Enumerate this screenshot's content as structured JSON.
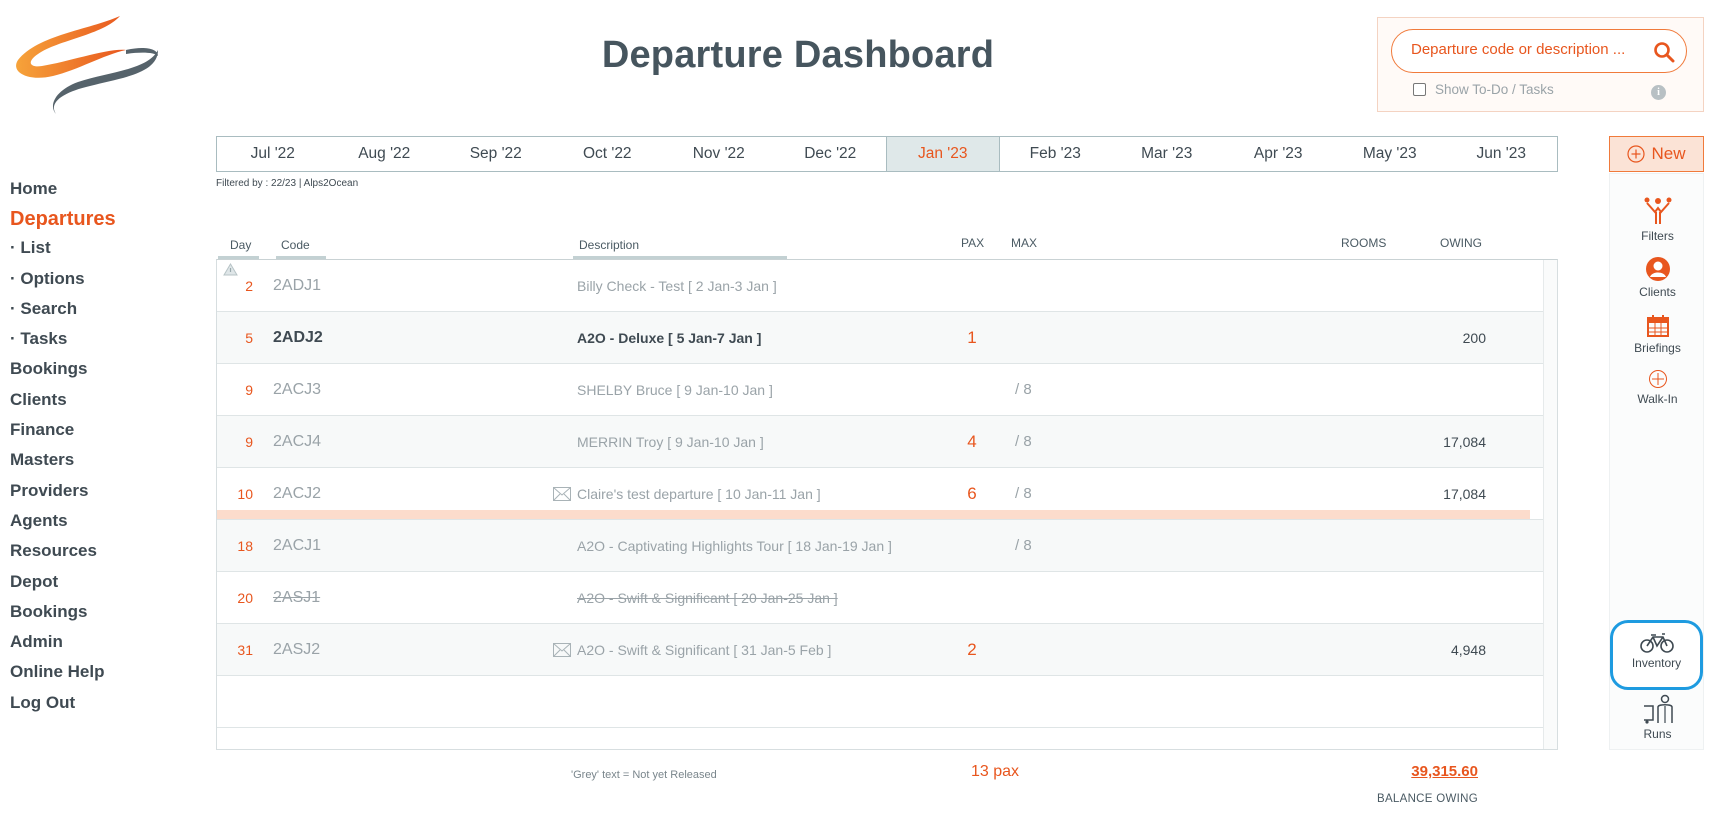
{
  "title": "Departure Dashboard",
  "search": {
    "placeholder": "Departure code or description ...",
    "value": ""
  },
  "todo": {
    "label": "Show To-Do / Tasks",
    "checked": false
  },
  "nav": {
    "home": "Home",
    "departures": "Departures",
    "list": "List",
    "options": "Options",
    "search": "Search",
    "tasks": "Tasks",
    "bookings": "Bookings",
    "clients": "Clients",
    "finance": "Finance",
    "masters": "Masters",
    "providers": "Providers",
    "agents": "Agents",
    "resources": "Resources",
    "depot": "Depot",
    "bookings2": "Bookings",
    "admin": "Admin",
    "help": "Online Help",
    "logout": "Log Out"
  },
  "months": [
    "Jul '22",
    "Aug '22",
    "Sep '22",
    "Oct '22",
    "Nov '22",
    "Dec '22",
    "Jan '23",
    "Feb '23",
    "Mar '23",
    "Apr '23",
    "May '23",
    "Jun '23"
  ],
  "active_month": "Jan '23",
  "filter_text": "Filtered by : 22/23 | Alps2Ocean",
  "new_button": "New",
  "tools": {
    "filters": "Filters",
    "clients": "Clients",
    "briefings": "Briefings",
    "walkin": "Walk-In",
    "inventory": "Inventory",
    "runs": "Runs"
  },
  "columns": {
    "day": "Day",
    "code": "Code",
    "description": "Description",
    "pax": "PAX",
    "max": "MAX",
    "rooms": "ROOMS",
    "owing": "OWING"
  },
  "rows": [
    {
      "day": "2",
      "code": "2ADJ1",
      "description": "Billy Check - Test  [ 2 Jan-3 Jan ]",
      "pax": "",
      "max": "",
      "owing": ""
    },
    {
      "day": "5",
      "code": "2ADJ2",
      "description": "A2O - Deluxe  [ 5 Jan-7 Jan ]",
      "pax": "1",
      "max": "",
      "owing": "200"
    },
    {
      "day": "9",
      "code": "2ACJ3",
      "description": "SHELBY Bruce  [ 9 Jan-10 Jan ]",
      "pax": "",
      "max": "/ 8",
      "owing": ""
    },
    {
      "day": "9",
      "code": "2ACJ4",
      "description": "MERRIN Troy  [ 9 Jan-10 Jan ]",
      "pax": "4",
      "max": "/ 8",
      "owing": "17,084"
    },
    {
      "day": "10",
      "code": "2ACJ2",
      "description": "Claire's test departure  [ 10 Jan-11 Jan ]",
      "pax": "6",
      "max": "/ 8",
      "owing": "17,084"
    },
    {
      "day": "18",
      "code": "2ACJ1",
      "description": "A2O - Captivating Highlights Tour  [ 18 Jan-19 Jan ]",
      "pax": "",
      "max": "/ 8",
      "owing": ""
    },
    {
      "day": "20",
      "code": "2ASJ1",
      "description": "A2O - Swift & Significant  [ 20 Jan-25 Jan ]",
      "pax": "",
      "max": "",
      "owing": ""
    },
    {
      "day": "31",
      "code": "2ASJ2",
      "description": "A2O - Swift & Significant  [ 31 Jan-5 Feb ]",
      "pax": "2",
      "max": "",
      "owing": "4,948"
    }
  ],
  "footer": {
    "note": "'Grey' text = Not yet Released",
    "total_pax": "13 pax",
    "total_owing": "39,315.60",
    "balance_label": "BALANCE OWING"
  },
  "colors": {
    "accent": "#e8561e",
    "text_dark": "#3f4a52",
    "text_grey": "#9aa3a8",
    "highlight_row": "#fcdccc",
    "selection_ring": "#1e9be0"
  }
}
